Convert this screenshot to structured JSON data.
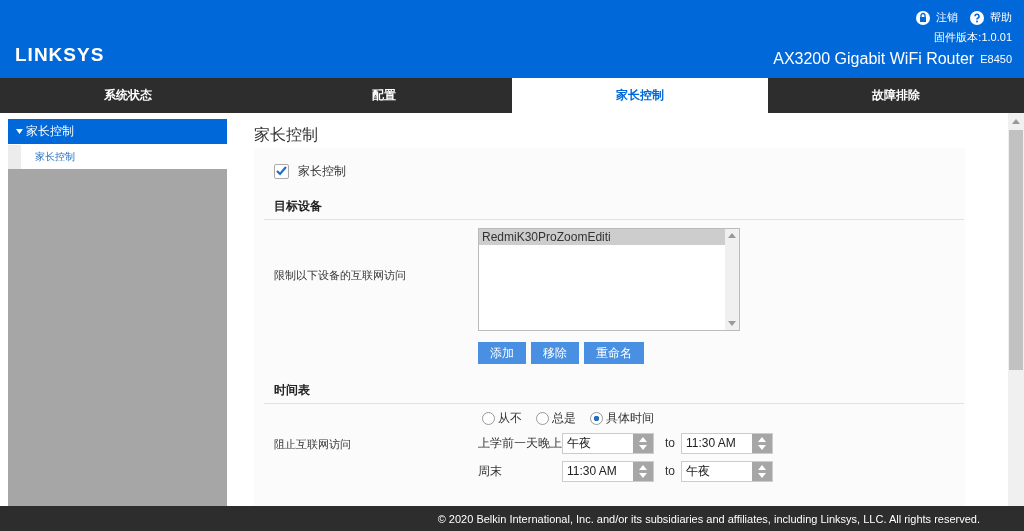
{
  "header": {
    "logo": "LINKSYS",
    "logout": "注销",
    "help": "帮助",
    "firmware": "固件版本:1.0.01",
    "product": "AX3200 Gigabit WiFi Router",
    "model": "E8450"
  },
  "tabs": [
    {
      "label": "系统状态",
      "selected": false
    },
    {
      "label": "配置",
      "selected": false
    },
    {
      "label": "家长控制",
      "selected": true
    },
    {
      "label": "故障排除",
      "selected": false
    }
  ],
  "sidebar": {
    "items": [
      {
        "label": "家长控制",
        "expanded": true,
        "children": [
          {
            "label": "家长控制",
            "selected": true
          }
        ]
      }
    ]
  },
  "page_title": "家长控制",
  "enable": {
    "label": "家长控制",
    "checked": true
  },
  "target": {
    "heading": "目标设备",
    "label": "限制以下设备的互联网访问",
    "devices": [
      {
        "name": "RedmiK30ProZoomEditi",
        "selected": true
      }
    ],
    "buttons": [
      "添加",
      "移除",
      "重命名"
    ]
  },
  "schedule": {
    "heading": "时间表",
    "label": "阻止互联网访问",
    "options": [
      {
        "label": "从不",
        "selected": false
      },
      {
        "label": "总是",
        "selected": false
      },
      {
        "label": "具体时间",
        "selected": true
      }
    ],
    "rows": [
      {
        "label": "上学前一天晚上",
        "from": "午夜",
        "to_word": "to",
        "to": "11:30 AM"
      },
      {
        "label": "周末",
        "from": "11:30 AM",
        "to_word": "to",
        "to": "午夜"
      }
    ]
  },
  "footer": "© 2020 Belkin International, Inc. and/or its subsidiaries and affiliates, including Linksys, LLC. All rights reserved."
}
